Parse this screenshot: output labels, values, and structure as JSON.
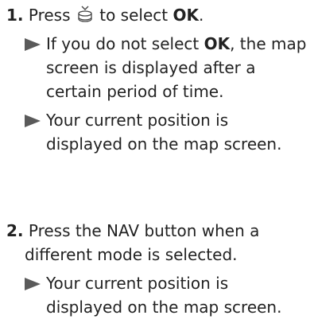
{
  "steps": [
    {
      "number": "1.",
      "text_before": "Press",
      "icon": "interface-dial-press-icon",
      "text_after": "to select",
      "bold_word": "OK",
      "end": ".",
      "bullets": [
        {
          "bold_prefix_before": "If you do not select",
          "bold_word": "OK",
          "rest": ", the map screen is displayed after a certain period of time."
        },
        {
          "text": "Your current position is displayed on the map screen."
        }
      ]
    },
    {
      "number": "2.",
      "line1": "Press the NAV button when a",
      "line2": "different mode is selected.",
      "bullets": [
        {
          "text": "Your current position is displayed on the map screen."
        }
      ]
    }
  ],
  "colors": {
    "text": "#222222",
    "bullet_triangle": "#5a5a5a"
  }
}
